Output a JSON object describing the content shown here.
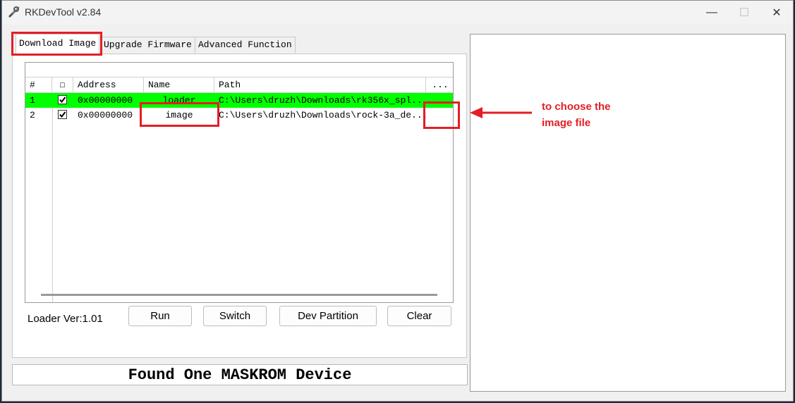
{
  "window": {
    "title": "RKDevTool v2.84",
    "minimize": "—",
    "maximize": "☐",
    "close": "✕"
  },
  "tabs": [
    "Download Image",
    "Upgrade Firmware",
    "Advanced Function"
  ],
  "table": {
    "headers": [
      "#",
      "☐",
      "Address",
      "Name",
      "Path",
      "..."
    ],
    "rows": [
      {
        "num": "1",
        "checked": true,
        "address": "0x00000000",
        "name": "loader",
        "path": "C:\\Users\\druzh\\Downloads\\rk356x_spl...",
        "highlight": true
      },
      {
        "num": "2",
        "checked": true,
        "address": "0x00000000",
        "name": "image",
        "path": "C:\\Users\\druzh\\Downloads\\rock-3a_de...",
        "highlight": false
      }
    ]
  },
  "loader_ver": "Loader Ver:1.01",
  "buttons": {
    "run": "Run",
    "switch": "Switch",
    "dev_partition": "Dev Partition",
    "clear": "Clear"
  },
  "status": "Found One MASKROM Device",
  "annotation": {
    "line1": "to choose the",
    "line2": "image file",
    "color": "#e31e24"
  },
  "colors": {
    "row_highlight": "#00ff00",
    "annotation": "#e31e24"
  }
}
